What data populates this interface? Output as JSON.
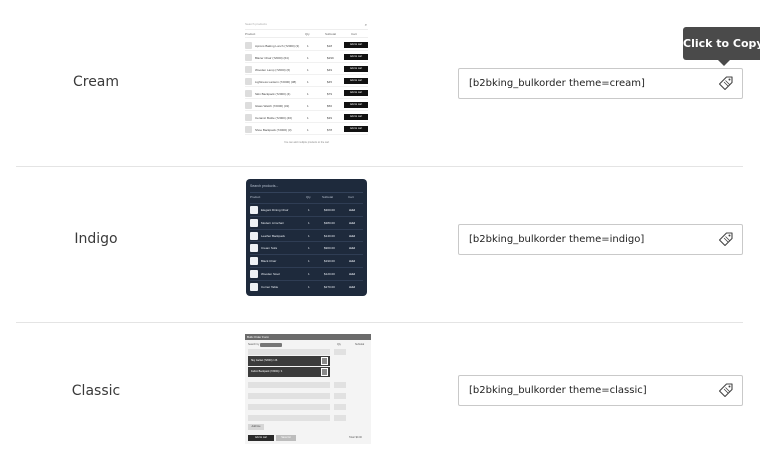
{
  "tooltip": {
    "text": "Click to Copy"
  },
  "themes": [
    {
      "name": "Cream",
      "shortcode": "[b2bking_bulkorder theme=cream]",
      "preview": {
        "search_placeholder": "Search products",
        "columns": [
          "Product",
          "Qty",
          "Subtotal",
          "Cart"
        ],
        "rows": [
          {
            "name": "Aprons Baking Lunch (72000) (3)",
            "qty": "1",
            "subtotal": "$18",
            "action": "Add to cart"
          },
          {
            "name": "Blazer Chair (72000) (64)",
            "qty": "1",
            "subtotal": "$299",
            "action": "Add to cart"
          },
          {
            "name": "Wooden Lamp (72000) (6)",
            "qty": "1",
            "subtotal": "$49",
            "action": "Add to cart"
          },
          {
            "name": "Lightness Lantern (72000) (38)",
            "qty": "1",
            "subtotal": "$45",
            "action": "Add to cart"
          },
          {
            "name": "Skin Backpack (72000) (4)",
            "qty": "1",
            "subtotal": "$79",
            "action": "Add to cart"
          },
          {
            "name": "Glass Watch (72000) (32)",
            "qty": "1",
            "subtotal": "$56",
            "action": "Add to cart"
          },
          {
            "name": "Ceramic Bottle (72000) (46)",
            "qty": "1",
            "subtotal": "$39",
            "action": "Add to cart"
          },
          {
            "name": "Shoe Backpack (72000) (3)",
            "qty": "1",
            "subtotal": "$78",
            "action": "Add to cart"
          }
        ],
        "footer": "You can add multiple products to the cart"
      }
    },
    {
      "name": "Indigo",
      "shortcode": "[b2bking_bulkorder theme=indigo]",
      "preview": {
        "search_placeholder": "Search products...",
        "columns": [
          "Product",
          "Qty",
          "Subtotal",
          "Cart"
        ],
        "rows": [
          {
            "name": "Elegant Dining Chair",
            "qty": "1",
            "subtotal": "$300.00",
            "action": "Add"
          },
          {
            "name": "Modern Armchair",
            "qty": "1",
            "subtotal": "$380.00",
            "action": "Add"
          },
          {
            "name": "Leather Backpack",
            "qty": "1",
            "subtotal": "$140.00",
            "action": "Add"
          },
          {
            "name": "Cream Sofa",
            "qty": "1",
            "subtotal": "$900.00",
            "action": "Add"
          },
          {
            "name": "Black Chair",
            "qty": "1",
            "subtotal": "$190.00",
            "action": "Add"
          },
          {
            "name": "Wooden Stool",
            "qty": "1",
            "subtotal": "$120.00",
            "action": "Add"
          },
          {
            "name": "Corner Table",
            "qty": "1",
            "subtotal": "$270.00",
            "action": "Add"
          }
        ]
      }
    },
    {
      "name": "Classic",
      "shortcode": "[b2bking_bulkorder theme=classic]",
      "preview": {
        "header_title": "Bulk Order Form",
        "search_label": "Search by",
        "columns": [
          "Qty",
          "Subtotal"
        ],
        "results": [
          {
            "name": "Sky Jacket (72000) / 26"
          },
          {
            "name": "Fabric Backpack (72000) / 4"
          }
        ],
        "add_line_label": "Add line",
        "add_to_cart_label": "Add to cart",
        "save_list_label": "Save list",
        "total_label": "Total: $0.00"
      }
    }
  ]
}
